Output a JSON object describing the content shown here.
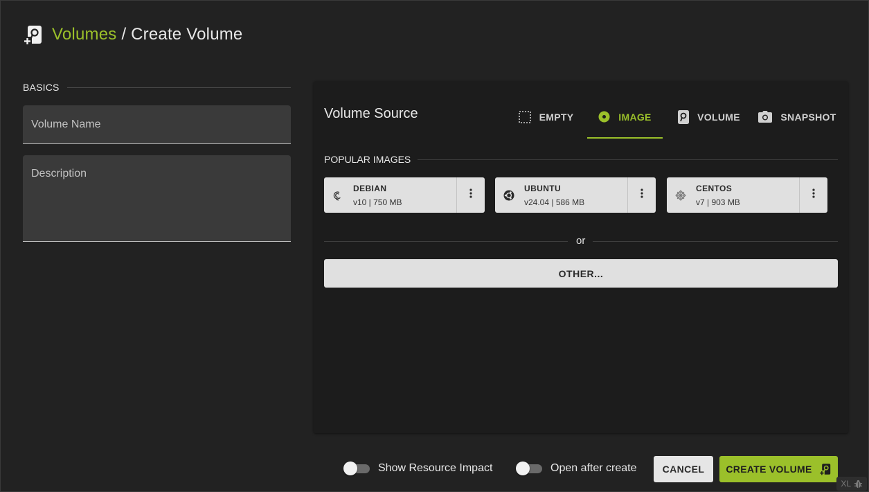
{
  "header": {
    "icon": "volume-add-icon",
    "breadcrumb_link": "Volumes",
    "separator": "/",
    "current": "Create Volume"
  },
  "basics": {
    "label": "BASICS",
    "name_placeholder": "Volume Name",
    "name_value": "",
    "description_placeholder": "Description",
    "description_value": ""
  },
  "source": {
    "title": "Volume Source",
    "tabs": [
      {
        "label": "EMPTY",
        "icon": "empty-dashed-square-icon",
        "active": false
      },
      {
        "label": "IMAGE",
        "icon": "radio-dot-icon",
        "active": true
      },
      {
        "label": "VOLUME",
        "icon": "volume-icon",
        "active": false
      },
      {
        "label": "SNAPSHOT",
        "icon": "camera-icon",
        "active": false
      }
    ],
    "popular_label": "POPULAR IMAGES",
    "images": [
      {
        "name": "DEBIAN",
        "meta": "v10 | 750 MB",
        "icon": "debian-logo-icon"
      },
      {
        "name": "UBUNTU",
        "meta": "v24.04 | 586 MB",
        "icon": "ubuntu-logo-icon"
      },
      {
        "name": "CENTOS",
        "meta": "v7 | 903 MB",
        "icon": "centos-logo-icon"
      }
    ],
    "or_text": "or",
    "other_button": "OTHER..."
  },
  "footer": {
    "toggle_resource_impact": {
      "label": "Show Resource Impact",
      "on": false
    },
    "toggle_open_after": {
      "label": "Open after create",
      "on": false
    },
    "cancel": "CANCEL",
    "create": "CREATE VOLUME"
  },
  "badge": {
    "text": "XL",
    "icon": "bug-icon"
  },
  "colors": {
    "accent": "#9bc02a",
    "background": "#222222",
    "panel": "#1c1c1c",
    "card": "#e0e0e0"
  }
}
